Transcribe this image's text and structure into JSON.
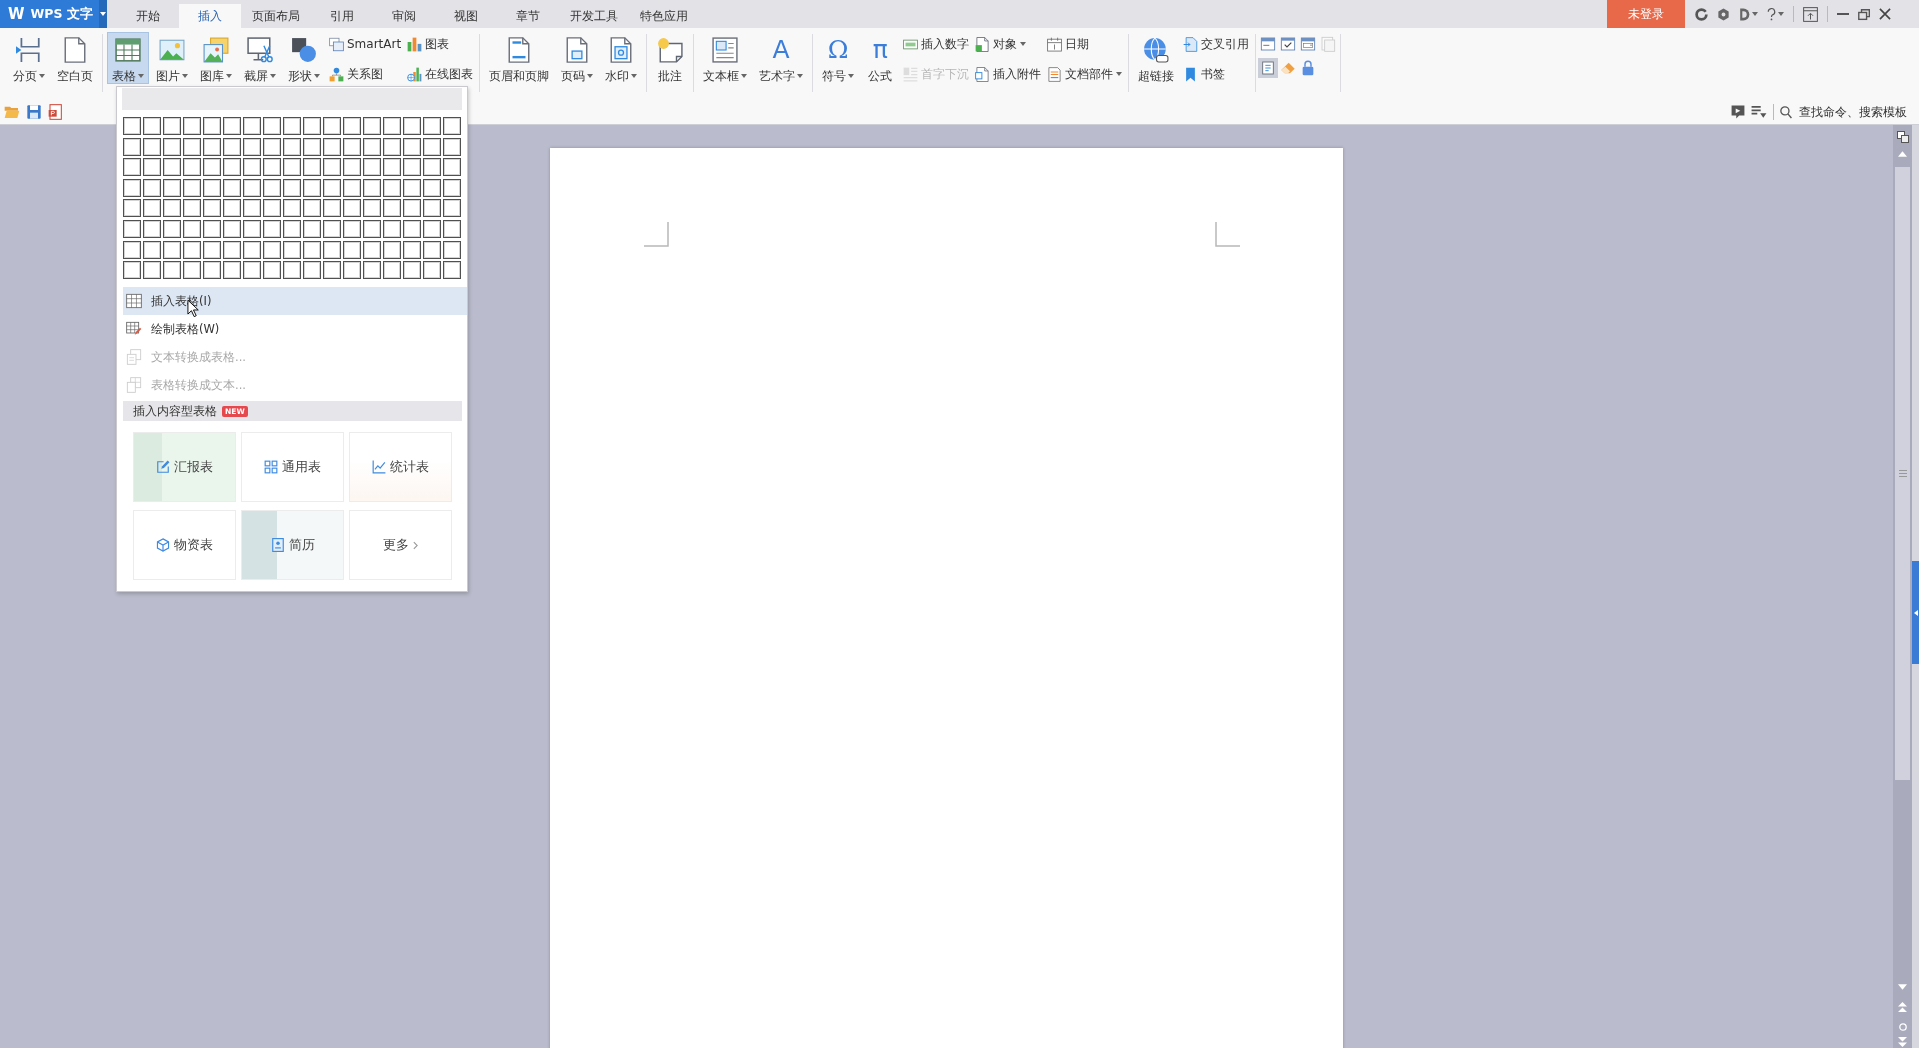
{
  "app_menu": {
    "logo": "W",
    "label": "WPS 文字"
  },
  "tabs": [
    {
      "label": "开始",
      "selected": false
    },
    {
      "label": "插入",
      "selected": true
    },
    {
      "label": "页面布局",
      "selected": false
    },
    {
      "label": "引用",
      "selected": false
    },
    {
      "label": "审阅",
      "selected": false
    },
    {
      "label": "视图",
      "selected": false
    },
    {
      "label": "章节",
      "selected": false
    },
    {
      "label": "开发工具",
      "selected": false
    },
    {
      "label": "特色应用",
      "selected": false
    }
  ],
  "login_button": {
    "label": "未登录"
  },
  "ribbon": {
    "groups": [
      {
        "items": [
          {
            "kind": "large",
            "label": "分页",
            "dropdown": true,
            "selected": false
          },
          {
            "kind": "large",
            "label": "空白页",
            "dropdown": false,
            "selected": false
          }
        ]
      },
      {
        "items": [
          {
            "kind": "large",
            "label": "表格",
            "dropdown": true,
            "selected": true
          },
          {
            "kind": "large",
            "label": "图片",
            "dropdown": true,
            "selected": false
          },
          {
            "kind": "large",
            "label": "图库",
            "dropdown": true,
            "selected": false
          },
          {
            "kind": "large",
            "label": "截屏",
            "dropdown": true,
            "selected": false
          },
          {
            "kind": "large",
            "label": "形状",
            "dropdown": true,
            "selected": false
          },
          {
            "kind": "stack",
            "buttons": [
              {
                "label": "SmartArt",
                "dropdown": false,
                "disabled": false
              },
              {
                "label": "关系图",
                "dropdown": false,
                "disabled": false
              }
            ]
          },
          {
            "kind": "stack",
            "buttons": [
              {
                "label": "图表",
                "dropdown": false,
                "disabled": false
              },
              {
                "label": "在线图表",
                "dropdown": false,
                "disabled": false
              }
            ]
          }
        ]
      },
      {
        "items": [
          {
            "kind": "large",
            "label": "页眉和页脚",
            "dropdown": false,
            "selected": false
          },
          {
            "kind": "large",
            "label": "页码",
            "dropdown": true,
            "selected": false
          },
          {
            "kind": "large",
            "label": "水印",
            "dropdown": true,
            "selected": false
          }
        ]
      },
      {
        "items": [
          {
            "kind": "large",
            "label": "批注",
            "dropdown": false,
            "selected": false
          }
        ]
      },
      {
        "items": [
          {
            "kind": "large",
            "label": "文本框",
            "dropdown": true,
            "selected": false
          },
          {
            "kind": "large",
            "glyph": "A",
            "label": "艺术字",
            "dropdown": true,
            "selected": false
          }
        ]
      },
      {
        "items": [
          {
            "kind": "large",
            "glyph": "Ω",
            "label": "符号",
            "dropdown": true,
            "selected": false
          },
          {
            "kind": "large",
            "glyph": "π",
            "label": "公式",
            "dropdown": false,
            "selected": false
          },
          {
            "kind": "stack",
            "buttons": [
              {
                "label": "插入数字",
                "dropdown": false,
                "disabled": false
              },
              {
                "label": "首字下沉",
                "dropdown": false,
                "disabled": true
              }
            ]
          },
          {
            "kind": "stack",
            "buttons": [
              {
                "label": "对象",
                "dropdown": true,
                "disabled": false
              },
              {
                "label": "插入附件",
                "dropdown": false,
                "disabled": false
              }
            ]
          },
          {
            "kind": "stack",
            "buttons": [
              {
                "label": "日期",
                "dropdown": false,
                "disabled": false
              },
              {
                "label": "文档部件",
                "dropdown": true,
                "disabled": false
              }
            ]
          }
        ]
      },
      {
        "items": [
          {
            "kind": "large",
            "label": "超链接",
            "dropdown": false,
            "selected": false
          },
          {
            "kind": "stack",
            "buttons": [
              {
                "label": "交叉引用",
                "dropdown": false,
                "disabled": false
              },
              {
                "label": "书签",
                "dropdown": false,
                "disabled": false
              }
            ]
          }
        ]
      },
      {
        "items": [
          {
            "kind": "icon_grid",
            "rows": [
              [
                {
                  "selected": false,
                  "disabled": false
                },
                {
                  "selected": false,
                  "disabled": false
                },
                {
                  "selected": false,
                  "disabled": false
                },
                {
                  "selected": false,
                  "disabled": true
                }
              ],
              [
                {
                  "selected": true,
                  "disabled": false
                },
                {
                  "selected": false,
                  "disabled": false
                },
                {
                  "selected": false,
                  "disabled": false
                }
              ]
            ]
          }
        ]
      }
    ]
  },
  "quick_access": {
    "search": {
      "placeholder": "查找命令、搜索模板"
    }
  },
  "table_menu": {
    "grid": {
      "rows": [
        {
          "cells": [
            {
              "selected": false
            },
            {
              "selected": false
            },
            {
              "selected": false
            },
            {
              "selected": false
            },
            {
              "selected": false
            },
            {
              "selected": false
            },
            {
              "selected": false
            },
            {
              "selected": false
            },
            {
              "selected": false
            },
            {
              "selected": false
            },
            {
              "selected": false
            },
            {
              "selected": false
            },
            {
              "selected": false
            },
            {
              "selected": false
            },
            {
              "selected": false
            },
            {
              "selected": false
            },
            {
              "selected": false
            }
          ]
        },
        {
          "cells": [
            {
              "selected": false
            },
            {
              "selected": false
            },
            {
              "selected": false
            },
            {
              "selected": false
            },
            {
              "selected": false
            },
            {
              "selected": false
            },
            {
              "selected": false
            },
            {
              "selected": false
            },
            {
              "selected": false
            },
            {
              "selected": false
            },
            {
              "selected": false
            },
            {
              "selected": false
            },
            {
              "selected": false
            },
            {
              "selected": false
            },
            {
              "selected": false
            },
            {
              "selected": false
            },
            {
              "selected": false
            }
          ]
        },
        {
          "cells": [
            {
              "selected": false
            },
            {
              "selected": false
            },
            {
              "selected": false
            },
            {
              "selected": false
            },
            {
              "selected": false
            },
            {
              "selected": false
            },
            {
              "selected": false
            },
            {
              "selected": false
            },
            {
              "selected": false
            },
            {
              "selected": false
            },
            {
              "selected": false
            },
            {
              "selected": false
            },
            {
              "selected": false
            },
            {
              "selected": false
            },
            {
              "selected": false
            },
            {
              "selected": false
            },
            {
              "selected": false
            }
          ]
        },
        {
          "cells": [
            {
              "selected": false
            },
            {
              "selected": false
            },
            {
              "selected": false
            },
            {
              "selected": false
            },
            {
              "selected": false
            },
            {
              "selected": false
            },
            {
              "selected": false
            },
            {
              "selected": false
            },
            {
              "selected": false
            },
            {
              "selected": false
            },
            {
              "selected": false
            },
            {
              "selected": false
            },
            {
              "selected": false
            },
            {
              "selected": false
            },
            {
              "selected": false
            },
            {
              "selected": false
            },
            {
              "selected": false
            }
          ]
        },
        {
          "cells": [
            {
              "selected": false
            },
            {
              "selected": false
            },
            {
              "selected": false
            },
            {
              "selected": false
            },
            {
              "selected": false
            },
            {
              "selected": false
            },
            {
              "selected": false
            },
            {
              "selected": false
            },
            {
              "selected": false
            },
            {
              "selected": false
            },
            {
              "selected": false
            },
            {
              "selected": false
            },
            {
              "selected": false
            },
            {
              "selected": false
            },
            {
              "selected": false
            },
            {
              "selected": false
            },
            {
              "selected": false
            }
          ]
        },
        {
          "cells": [
            {
              "selected": false
            },
            {
              "selected": false
            },
            {
              "selected": false
            },
            {
              "selected": false
            },
            {
              "selected": false
            },
            {
              "selected": false
            },
            {
              "selected": false
            },
            {
              "selected": false
            },
            {
              "selected": false
            },
            {
              "selected": false
            },
            {
              "selected": false
            },
            {
              "selected": false
            },
            {
              "selected": false
            },
            {
              "selected": false
            },
            {
              "selected": false
            },
            {
              "selected": false
            },
            {
              "selected": false
            }
          ]
        },
        {
          "cells": [
            {
              "selected": false
            },
            {
              "selected": false
            },
            {
              "selected": false
            },
            {
              "selected": false
            },
            {
              "selected": false
            },
            {
              "selected": false
            },
            {
              "selected": false
            },
            {
              "selected": false
            },
            {
              "selected": false
            },
            {
              "selected": false
            },
            {
              "selected": false
            },
            {
              "selected": false
            },
            {
              "selected": false
            },
            {
              "selected": false
            },
            {
              "selected": false
            },
            {
              "selected": false
            },
            {
              "selected": false
            }
          ]
        },
        {
          "cells": [
            {
              "selected": false
            },
            {
              "selected": false
            },
            {
              "selected": false
            },
            {
              "selected": false
            },
            {
              "selected": false
            },
            {
              "selected": false
            },
            {
              "selected": false
            },
            {
              "selected": false
            },
            {
              "selected": false
            },
            {
              "selected": false
            },
            {
              "selected": false
            },
            {
              "selected": false
            },
            {
              "selected": false
            },
            {
              "selected": false
            },
            {
              "selected": false
            },
            {
              "selected": false
            },
            {
              "selected": false
            }
          ]
        }
      ]
    },
    "items": [
      {
        "label": "插入表格(I)",
        "selected": true,
        "disabled": false
      },
      {
        "label": "绘制表格(W)",
        "selected": false,
        "disabled": false
      },
      {
        "label": "文本转换成表格...",
        "selected": false,
        "disabled": true
      },
      {
        "label": "表格转换成文本...",
        "selected": false,
        "disabled": true
      }
    ],
    "section": {
      "label": "插入内容型表格",
      "badge": "NEW"
    },
    "templates": [
      {
        "kind": "template",
        "label": "汇报表"
      },
      {
        "kind": "template",
        "label": "通用表"
      },
      {
        "kind": "template",
        "label": "统计表"
      },
      {
        "kind": "template",
        "label": "物资表"
      },
      {
        "kind": "template",
        "label": "简历"
      },
      {
        "kind": "more",
        "label": "更多"
      }
    ]
  }
}
